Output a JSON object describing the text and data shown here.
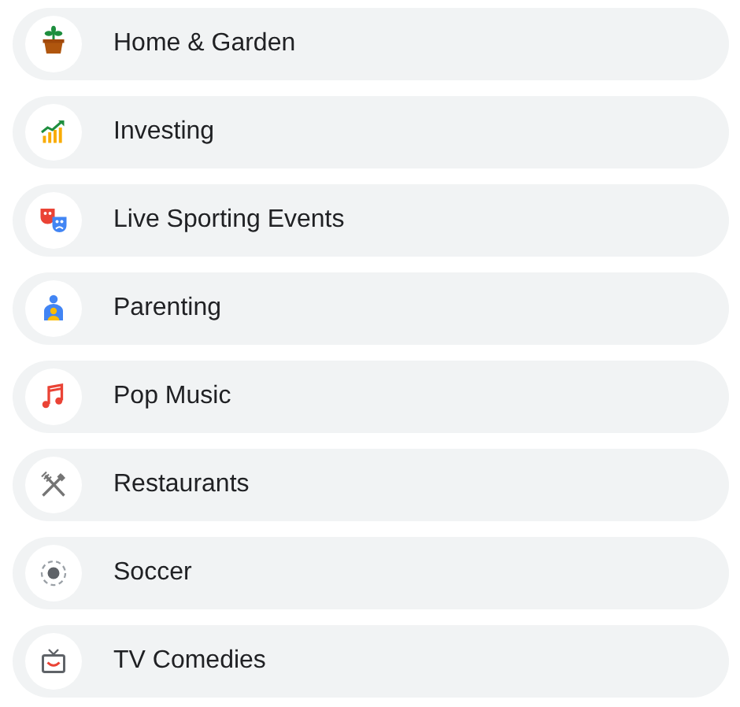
{
  "topics": [
    {
      "label": "Home & Garden",
      "kind": "plant"
    },
    {
      "label": "Investing",
      "kind": "chart"
    },
    {
      "label": "Live Sporting Events",
      "kind": "masks"
    },
    {
      "label": "Parenting",
      "kind": "parent"
    },
    {
      "label": "Pop Music",
      "kind": "music"
    },
    {
      "label": "Restaurants",
      "kind": "cutlery"
    },
    {
      "label": "Soccer",
      "kind": "ball"
    },
    {
      "label": "TV Comedies",
      "kind": "tv"
    }
  ]
}
